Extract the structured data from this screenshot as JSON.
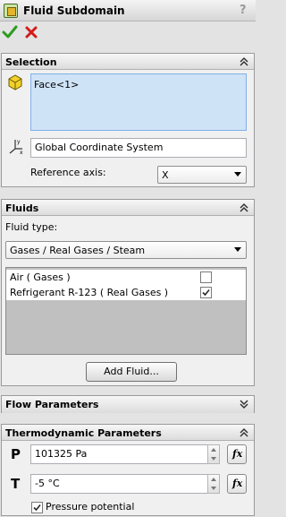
{
  "title": "Fluid Subdomain",
  "help_symbol": "?",
  "selection": {
    "header": "Selection",
    "items": [
      "Face<1>"
    ],
    "coordinate_system": "Global Coordinate System",
    "reference_axis_label": "Reference axis:",
    "reference_axis_value": "X"
  },
  "fluids": {
    "header": "Fluids",
    "fluid_type_label": "Fluid type:",
    "fluid_type_value": "Gases / Real Gases / Steam",
    "list": [
      {
        "name": "Air ( Gases )",
        "checked": false
      },
      {
        "name": "Refrigerant R-123 ( Real Gases )",
        "checked": true
      }
    ],
    "add_button": "Add Fluid..."
  },
  "flow_parameters": {
    "header": "Flow Parameters"
  },
  "thermo": {
    "header": "Thermodynamic Parameters",
    "p_symbol": "P",
    "p_value": "101325 Pa",
    "t_symbol": "T",
    "t_value": "-5 °C",
    "fx_label": "fx",
    "pressure_potential_label": "Pressure potential",
    "pressure_potential_checked": true
  },
  "colors": {
    "ok": "#2e9b1f",
    "cancel": "#d21b1b",
    "selection_bg": "#cfe3f7"
  }
}
